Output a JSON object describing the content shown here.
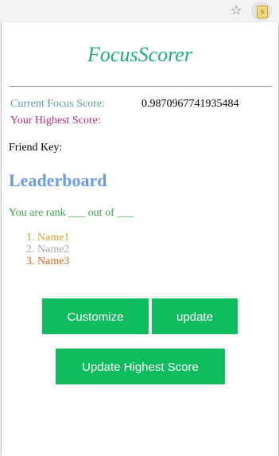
{
  "app": {
    "title": "FocusScorer"
  },
  "browser": {
    "star_icon": "☆",
    "extension_badge": "S"
  },
  "scores": {
    "current_label": "Current Focus Score:",
    "current_value": "0.9870967741935484",
    "highest_label": "Your Highest Score:"
  },
  "friend": {
    "key_label": "Friend Key:"
  },
  "leaderboard": {
    "title": "Leaderboard",
    "rank_text": "You are rank ___ out of ___",
    "entries": [
      {
        "label": "1. Name1",
        "color": "#d4a030"
      },
      {
        "label": "2. Name2",
        "color": "#a8a8a8"
      },
      {
        "label": "3. Name3",
        "color": "#d2691e"
      }
    ]
  },
  "buttons": {
    "customize": "Customize",
    "update": "update",
    "update_highest": "Update Highest Score"
  },
  "colors": {
    "title": "#1fae84",
    "button": "#0fbd5e",
    "leaderboard_title": "#6b9be0",
    "rank_text": "#3aa04a"
  }
}
